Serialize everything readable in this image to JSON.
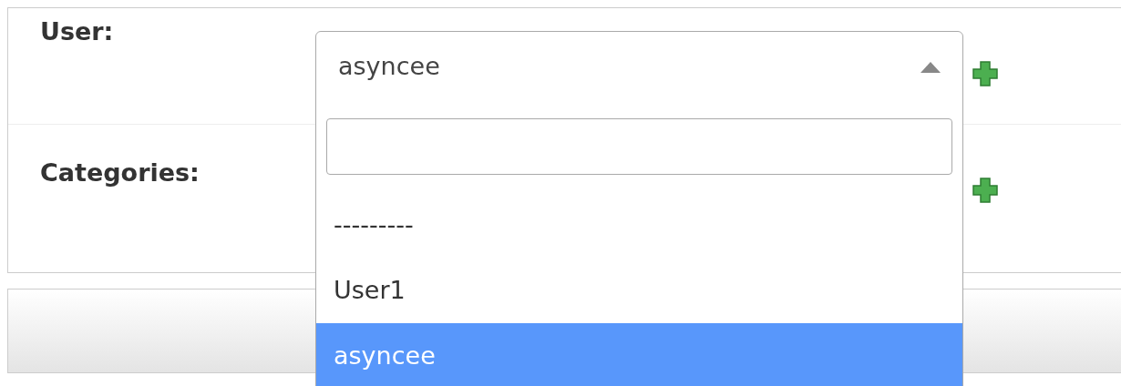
{
  "fields": [
    {
      "label": "User:",
      "kind": "select",
      "value": "asyncee",
      "expanded": true
    },
    {
      "label": "Categories:",
      "kind": "multi"
    }
  ],
  "dropdown": {
    "options": [
      {
        "label": "---------",
        "selected": false
      },
      {
        "label": "User1",
        "selected": false
      },
      {
        "label": "asyncee",
        "selected": true
      }
    ]
  }
}
